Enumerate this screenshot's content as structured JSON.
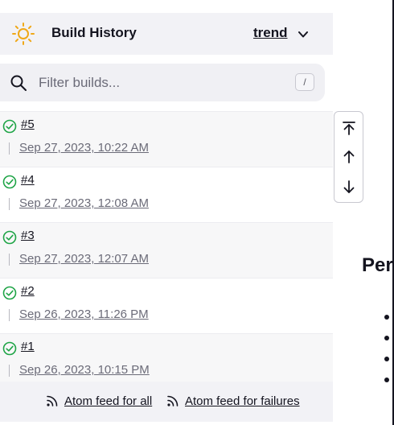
{
  "build_history": {
    "title": "Build History",
    "trend_label": "trend",
    "filter": {
      "placeholder": "Filter builds...",
      "shortcut": "/"
    },
    "builds": [
      {
        "number": "#5",
        "date": "Sep 27, 2023, 10:22 AM",
        "status": "success"
      },
      {
        "number": "#4",
        "date": "Sep 27, 2023, 12:08 AM",
        "status": "success"
      },
      {
        "number": "#3",
        "date": "Sep 27, 2023, 12:07 AM",
        "status": "success"
      },
      {
        "number": "#2",
        "date": "Sep 26, 2023, 11:26 PM",
        "status": "success"
      },
      {
        "number": "#1",
        "date": "Sep 26, 2023, 10:15 PM",
        "status": "success"
      }
    ],
    "feeds": {
      "all": "Atom feed for all",
      "failures": "Atom feed for failures"
    }
  },
  "scroll_nav": {
    "icons": [
      "scroll-to-top-icon",
      "arrow-up-icon",
      "arrow-down-icon"
    ]
  },
  "main": {
    "heading_partial": "Per"
  },
  "colors": {
    "success": "#1ea446",
    "sun": "#f0a818",
    "text": "#14141f"
  }
}
